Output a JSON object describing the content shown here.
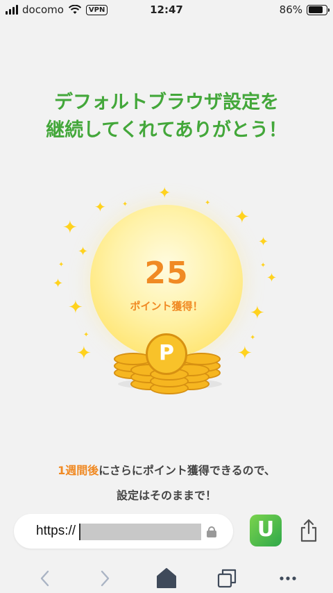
{
  "status_bar": {
    "carrier": "docomo",
    "vpn": "VPN",
    "time": "12:47",
    "battery": "86%",
    "battery_level": 0.86
  },
  "headline": {
    "line1": "デフォルトブラウザ設定を",
    "line2": "継続してくれてありがとう！"
  },
  "reward": {
    "points": "25",
    "label": "ポイント獲得！",
    "coin_letter": "P"
  },
  "message": {
    "highlight": "1週間後",
    "line1_rest": "にさらにポイント獲得できるので、",
    "line2": "設定はそのままで！"
  },
  "browser": {
    "url_prefix": "https://",
    "app_letter": "U"
  },
  "icons": {
    "back": "chevron-left-icon",
    "forward": "chevron-right-icon",
    "home": "home-icon",
    "tabs": "tabs-icon",
    "more": "more-icon",
    "share": "share-icon",
    "lock": "lock-icon"
  },
  "colors": {
    "accent_green": "#43a73a",
    "accent_orange": "#f08a24",
    "coin": "#f6b620"
  }
}
